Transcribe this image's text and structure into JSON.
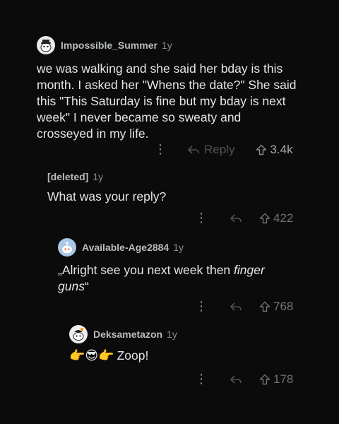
{
  "comments": [
    {
      "author": "Impossible_Summer",
      "age": "1y",
      "text": "we was walking and she said her bday is this month. I asked her \"Whens the date?\" She said this \"This Saturday is fine but my bday is next week\" I never became so sweaty and crosseyed in my life.",
      "reply_label": "Reply",
      "votes": "3.4k"
    },
    {
      "author": "[deleted]",
      "age": "1y",
      "text": "What was your reply?",
      "votes": "422"
    },
    {
      "author": "Available-Age2884",
      "age": "1y",
      "text_plain": "„Alright see you next week then ",
      "text_italic": "finger guns",
      "text_end": "“",
      "votes": "768"
    },
    {
      "author": "Deksametazon",
      "age": "1y",
      "emoji": "👉😎👉",
      "text": "Zoop!",
      "votes": "178"
    }
  ],
  "colors": {
    "background": "#0b0b0b",
    "text": "#e3e5e7",
    "meta": "#8a8e91",
    "action": "#6b6f72"
  },
  "icons": [
    "snoo-avatar-icon",
    "more-options-icon",
    "reply-icon",
    "upvote-icon"
  ]
}
